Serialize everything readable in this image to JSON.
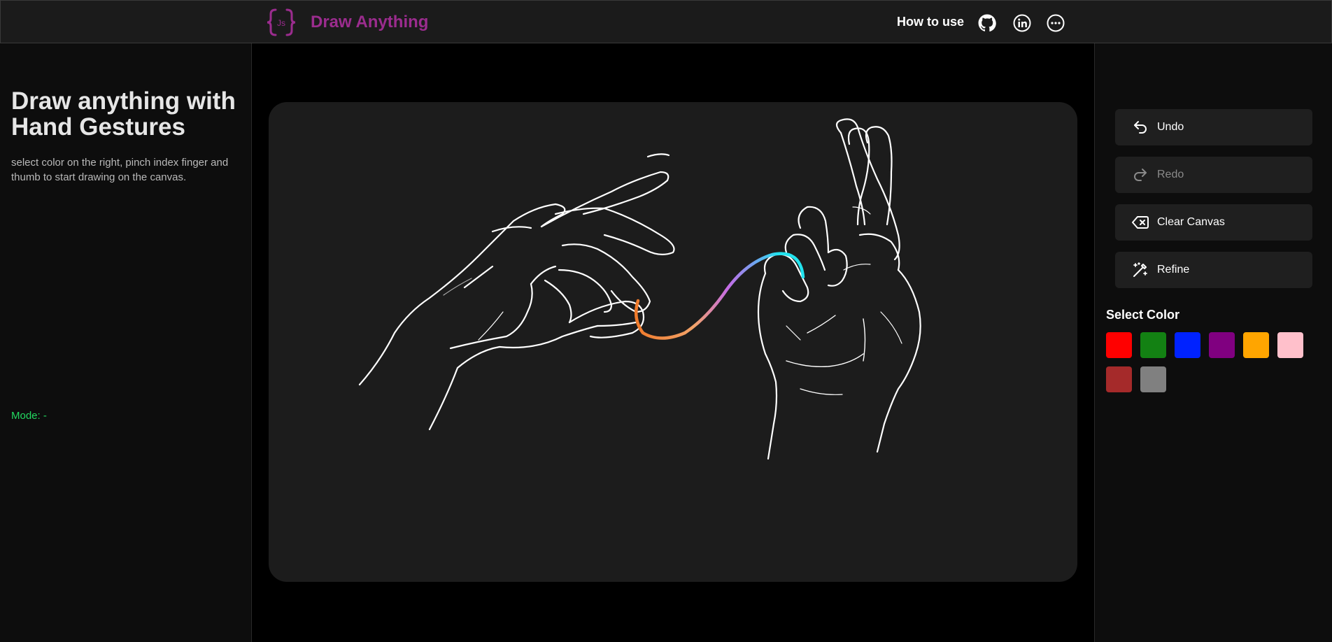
{
  "header": {
    "brand": "Draw Anything",
    "logo_text": "Js",
    "nav_how": "How to use",
    "icons": [
      "github-icon",
      "linkedin-icon",
      "more-icon"
    ]
  },
  "left": {
    "title": "Draw anything with Hand Gestures",
    "description": "select color on the right, pinch index finger and thumb to start drawing on the canvas.",
    "mode": "Mode: -"
  },
  "toolbar": {
    "undo": "Undo",
    "redo": "Redo",
    "clear": "Clear Canvas",
    "refine": "Refine"
  },
  "colors": {
    "title": "Select Color",
    "swatches": [
      "#ff0000",
      "#138113",
      "#0022ff",
      "#800080",
      "#ffa500",
      "#ffc0cb",
      "#a52a2a",
      "#808080"
    ]
  },
  "theme": {
    "brand_color": "#9b2c8e",
    "mode_color": "#22d860"
  }
}
